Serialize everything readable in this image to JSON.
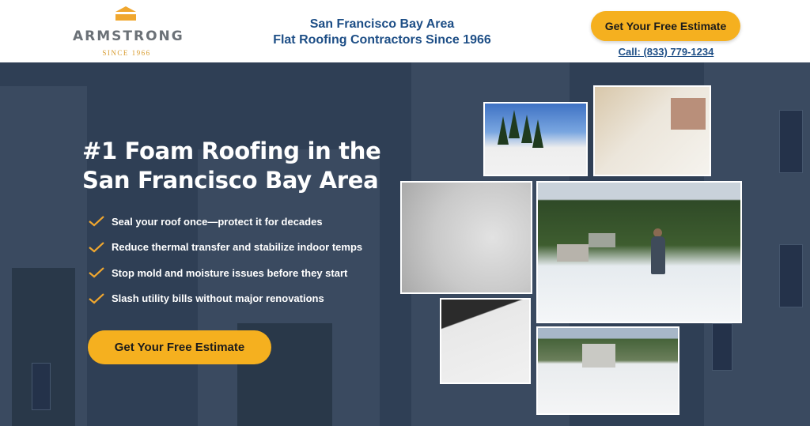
{
  "header": {
    "logo": {
      "name": "ARMSTRONG",
      "since": "SINCE 1966",
      "mark_color": "#f0a72f"
    },
    "tagline_line1": "San Francisco Bay Area",
    "tagline_line2": "Flat Roofing Contractors Since 1966",
    "cta_label": "Get Your Free Estimate",
    "call_label": "Call: (833) 779-1234"
  },
  "hero": {
    "headline_line1": "#1 Foam Roofing in the",
    "headline_line2": "San Francisco Bay Area",
    "bullets": [
      "Seal your roof once—protect it for decades",
      "Reduce thermal transfer and stabilize indoor temps",
      "Stop mold and moisture issues before they start",
      "Slash utility bills without major renovations"
    ],
    "bullet_icon": "check-icon",
    "cta_label": "Get Your Free Estimate"
  },
  "colors": {
    "accent": "#f5b01f",
    "brand_blue": "#1d4e86",
    "hero_bg": "#2f3f55",
    "check": "#f0a72f"
  }
}
